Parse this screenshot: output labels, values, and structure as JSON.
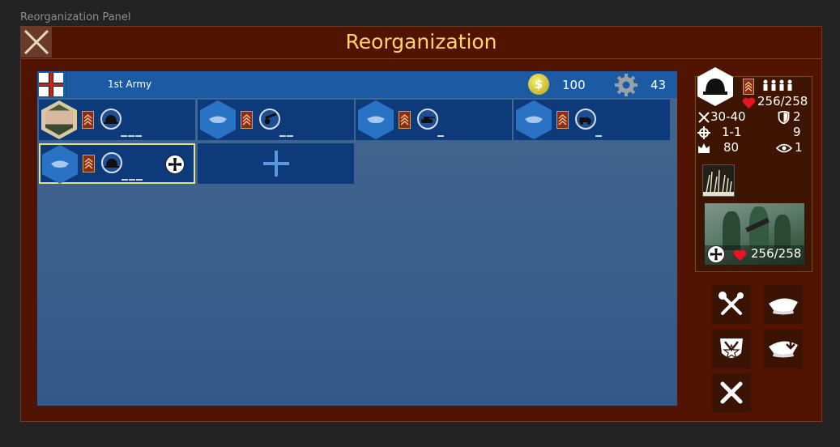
{
  "window": {
    "caption": "Reorganization Panel"
  },
  "header": {
    "title": "Reorganization"
  },
  "army": {
    "name": "1st Army",
    "money": "100",
    "money_symbol": "$",
    "parts": "43"
  },
  "units": [
    {
      "type": "commander",
      "icon": "soldier-helmet-icon"
    },
    {
      "type": "artillery",
      "icon": "howitzer-icon"
    },
    {
      "type": "tank",
      "icon": "tank-icon"
    },
    {
      "type": "armored-car",
      "icon": "armored-car-icon"
    },
    {
      "type": "infantry",
      "icon": "soldier-helmet-icon",
      "selected": true,
      "has_iron_cross": true
    }
  ],
  "info": {
    "hp_top": "256/258",
    "attack": "30-40",
    "defense": "2",
    "range": "1-1",
    "movement_val": "9",
    "supply": "80",
    "vision": "1",
    "hp_bottom": "256/258"
  },
  "colors": {
    "accent": "#ffd36b",
    "panel": "#521402",
    "army_bg": "#33598a",
    "slot": "#0d3a7a",
    "health": "#e8141e"
  }
}
